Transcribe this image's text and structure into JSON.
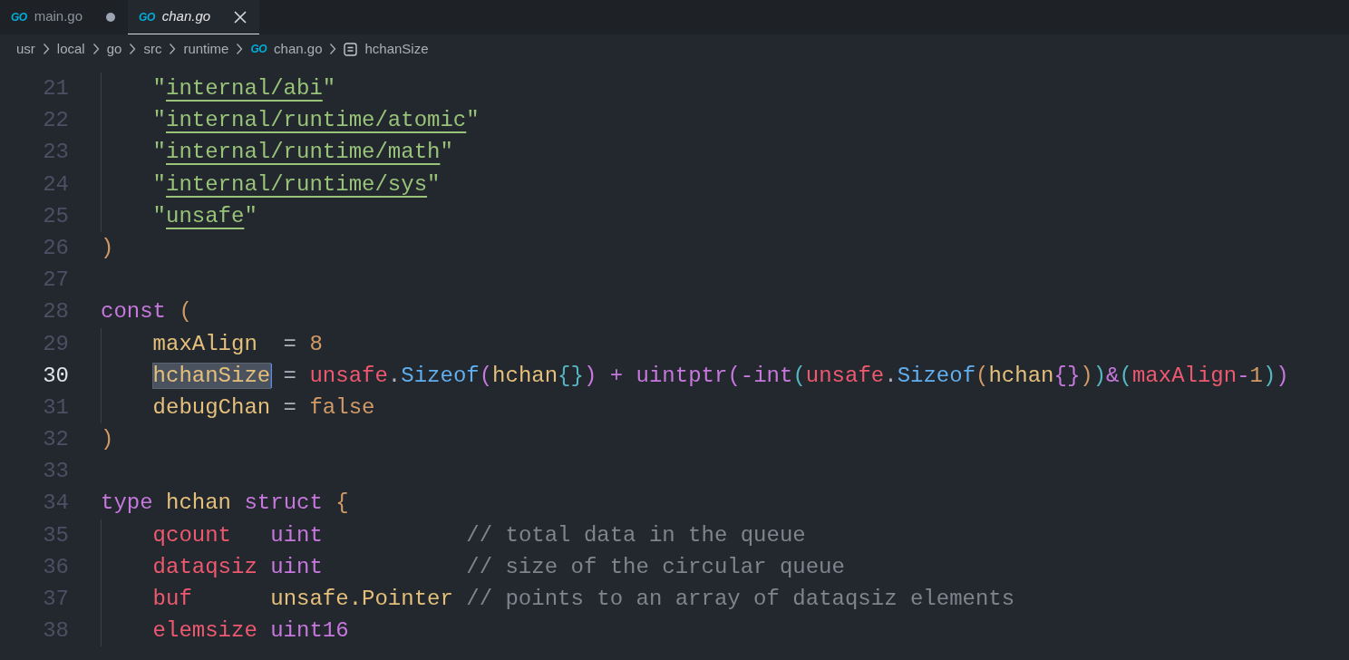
{
  "tabs": [
    {
      "icon_label": "GO",
      "label": "main.go",
      "selected": false,
      "modified": true,
      "preview": false
    },
    {
      "icon_label": "GO",
      "label": "chan.go",
      "selected": true,
      "modified": false,
      "preview": true
    }
  ],
  "breadcrumb": [
    {
      "kind": "folder",
      "label": "usr"
    },
    {
      "kind": "folder",
      "label": "local"
    },
    {
      "kind": "folder",
      "label": "go"
    },
    {
      "kind": "folder",
      "label": "src"
    },
    {
      "kind": "folder",
      "label": "runtime"
    },
    {
      "kind": "file",
      "icon_label": "GO",
      "label": "chan.go"
    },
    {
      "kind": "symbol",
      "label": "hchanSize"
    }
  ],
  "lines": [
    {
      "number": "21",
      "indented": true,
      "active": false,
      "tokens": [
        {
          "kind": "string",
          "text": "\""
        },
        {
          "kind": "link",
          "text": "internal/abi"
        },
        {
          "kind": "string",
          "text": "\""
        }
      ]
    },
    {
      "number": "22",
      "indented": true,
      "active": false,
      "tokens": [
        {
          "kind": "string",
          "text": "\""
        },
        {
          "kind": "link",
          "text": "internal/runtime/atomic"
        },
        {
          "kind": "string",
          "text": "\""
        }
      ]
    },
    {
      "number": "23",
      "indented": true,
      "active": false,
      "tokens": [
        {
          "kind": "string",
          "text": "\""
        },
        {
          "kind": "link",
          "text": "internal/runtime/math"
        },
        {
          "kind": "string",
          "text": "\""
        }
      ]
    },
    {
      "number": "24",
      "indented": true,
      "active": false,
      "tokens": [
        {
          "kind": "string",
          "text": "\""
        },
        {
          "kind": "link",
          "text": "internal/runtime/sys"
        },
        {
          "kind": "string",
          "text": "\""
        }
      ]
    },
    {
      "number": "25",
      "indented": true,
      "active": false,
      "tokens": [
        {
          "kind": "string",
          "text": "\""
        },
        {
          "kind": "link",
          "text": "unsafe"
        },
        {
          "kind": "string",
          "text": "\""
        }
      ]
    },
    {
      "number": "26",
      "indented": false,
      "active": false,
      "tokens": [
        {
          "kind": "bracket1",
          "text": ")"
        }
      ]
    },
    {
      "number": "27",
      "indented": false,
      "active": false
    },
    {
      "number": "28",
      "indented": false,
      "active": false,
      "tokens": [
        {
          "kind": "keyword",
          "text": "const"
        },
        {
          "kind": "bracket1",
          "text": " ("
        }
      ]
    },
    {
      "number": "29",
      "indented": true,
      "active": false,
      "tokens": [
        {
          "kind": "constant",
          "text": "maxAlign"
        },
        {
          "kind": "plain",
          "text": "  = "
        },
        {
          "kind": "number",
          "text": "8"
        }
      ]
    },
    {
      "number": "30",
      "indented": true,
      "active": true,
      "tokens": [
        {
          "kind": "constant",
          "text": "hchanSize"
        },
        {
          "kind": "plain",
          "text": " = "
        },
        {
          "kind": "package",
          "text": "unsafe"
        },
        {
          "kind": "plain",
          "text": "."
        },
        {
          "kind": "func",
          "text": "Sizeof"
        },
        {
          "kind": "bracket2",
          "text": "("
        },
        {
          "kind": "constant",
          "text": "hchan"
        },
        {
          "kind": "bracket3",
          "text": "{}"
        },
        {
          "kind": "bracket2",
          "text": ")"
        },
        {
          "kind": "operator",
          "text": " + "
        },
        {
          "kind": "keyword",
          "text": "uintptr"
        },
        {
          "kind": "bracket2",
          "text": "("
        },
        {
          "kind": "operator",
          "text": "-"
        },
        {
          "kind": "keyword",
          "text": "int"
        },
        {
          "kind": "bracket3",
          "text": "("
        },
        {
          "kind": "package",
          "text": "unsafe"
        },
        {
          "kind": "plain",
          "text": "."
        },
        {
          "kind": "func",
          "text": "Sizeof"
        },
        {
          "kind": "bracket1",
          "text": "("
        },
        {
          "kind": "constant",
          "text": "hchan"
        },
        {
          "kind": "bracket2",
          "text": "{}"
        },
        {
          "kind": "bracket1",
          "text": ")"
        },
        {
          "kind": "bracket3",
          "text": ")"
        },
        {
          "kind": "operator",
          "text": "&"
        },
        {
          "kind": "bracket3",
          "text": "("
        },
        {
          "kind": "package",
          "text": "maxAlign"
        },
        {
          "kind": "operator",
          "text": "-"
        },
        {
          "kind": "number",
          "text": "1"
        },
        {
          "kind": "bracket3",
          "text": ")"
        },
        {
          "kind": "bracket2",
          "text": ")"
        }
      ]
    },
    {
      "number": "31",
      "indented": true,
      "active": false,
      "tokens": [
        {
          "kind": "constant",
          "text": "debugChan"
        },
        {
          "kind": "plain",
          "text": " = "
        },
        {
          "kind": "number",
          "text": "false"
        }
      ]
    },
    {
      "number": "32",
      "indented": false,
      "active": false,
      "tokens": [
        {
          "kind": "bracket1",
          "text": ")"
        }
      ]
    },
    {
      "number": "33",
      "indented": false,
      "active": false
    },
    {
      "number": "34",
      "indented": false,
      "active": false,
      "tokens": [
        {
          "kind": "keyword",
          "text": "type"
        },
        {
          "kind": "constant",
          "text": " hchan"
        },
        {
          "kind": "keyword",
          "text": " struct"
        },
        {
          "kind": "bracket1",
          "text": " {"
        }
      ]
    },
    {
      "number": "35",
      "indented": true,
      "active": false,
      "tokens": [
        {
          "kind": "package",
          "text": "qcount"
        },
        {
          "kind": "keyword",
          "text": "   uint"
        },
        {
          "kind": "comment",
          "text": "           // total data in the queue"
        }
      ]
    },
    {
      "number": "36",
      "indented": true,
      "active": false,
      "tokens": [
        {
          "kind": "package",
          "text": "dataqsiz"
        },
        {
          "kind": "keyword",
          "text": " uint"
        },
        {
          "kind": "comment",
          "text": "           // size of the circular queue"
        }
      ]
    },
    {
      "number": "37",
      "indented": true,
      "active": false,
      "tokens": [
        {
          "kind": "package",
          "text": "buf"
        },
        {
          "kind": "constant",
          "text": "      unsafe.Pointer"
        },
        {
          "kind": "comment",
          "text": " // points to an array of dataqsiz elements"
        }
      ]
    },
    {
      "number": "38",
      "indented": true,
      "active": false,
      "tokens": [
        {
          "kind": "package",
          "text": "elemsize"
        },
        {
          "kind": "keyword",
          "text": " uint16"
        }
      ]
    }
  ]
}
